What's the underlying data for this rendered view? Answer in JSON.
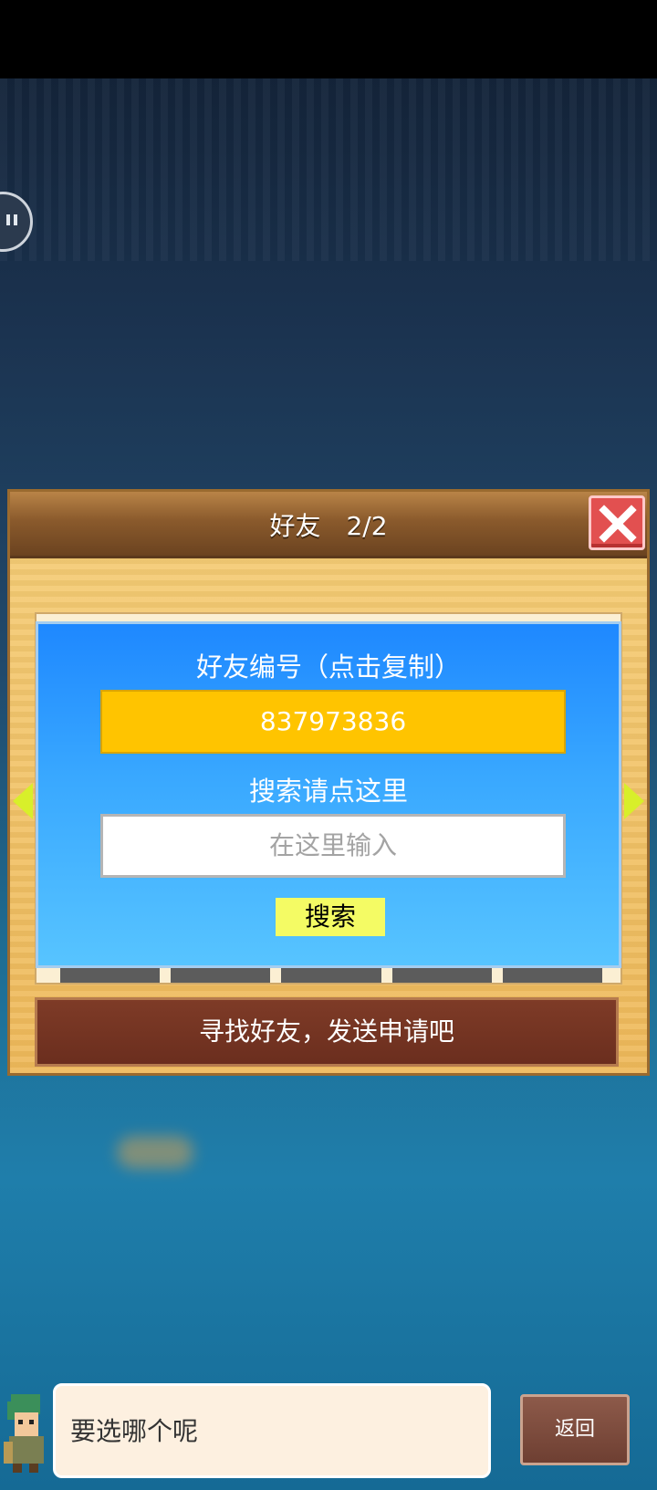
{
  "dialog": {
    "title": "好友　2/2"
  },
  "friend_panel": {
    "id_label": "好友编号（点击复制）",
    "friend_id": "837973836",
    "search_hint": "搜索请点这里",
    "search_placeholder": "在这里输入",
    "search_button": "搜索"
  },
  "find_friends_label": "寻找好友，发送申请吧",
  "bottom": {
    "speech_text": "要选哪个呢",
    "back_label": "返回"
  },
  "colors": {
    "accent_yellow": "#ffc400",
    "panel_blue": "#39a8ff",
    "close_red": "#e25050"
  },
  "icons": [
    "close-icon",
    "arrow-left-icon",
    "arrow-right-icon",
    "pause-icon",
    "character-avatar-icon"
  ]
}
